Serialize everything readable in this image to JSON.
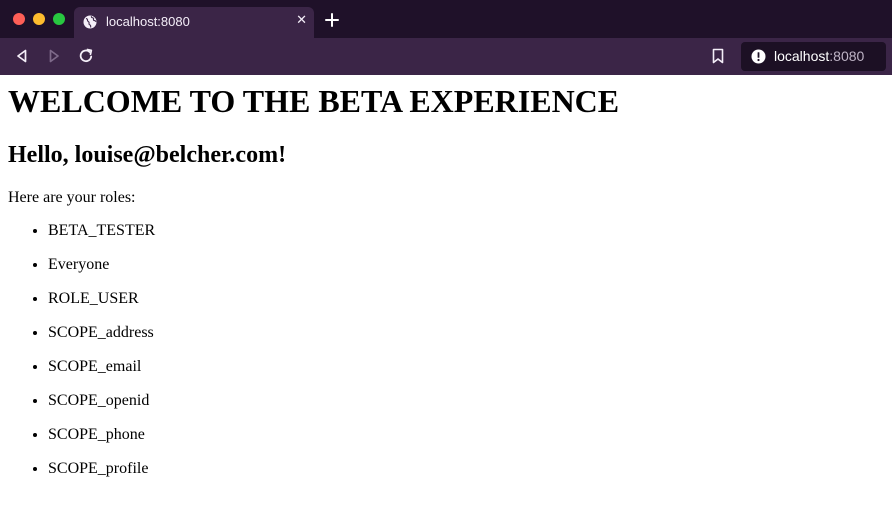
{
  "browser": {
    "tab": {
      "title": "localhost:8080",
      "close_glyph": "✕",
      "icon": "globe-icon"
    },
    "new_tab_icon": "plus-icon",
    "nav": {
      "back_icon": "back-icon",
      "forward_icon": "forward-icon",
      "reload_icon": "reload-icon"
    },
    "bookmark_icon": "bookmark-icon",
    "address": {
      "host": "localhost",
      "port": ":8080",
      "info_icon": "info-icon"
    },
    "colors": {
      "tabbar": "#1f1129",
      "toolbar": "#3b2547",
      "urlbar": "#1c1024"
    }
  },
  "page": {
    "heading": "WELCOME TO THE BETA EXPERIENCE",
    "greeting": "Hello, louise@belcher.com!",
    "roles_intro": "Here are your roles:",
    "roles": [
      "BETA_TESTER",
      "Everyone",
      "ROLE_USER",
      "SCOPE_address",
      "SCOPE_email",
      "SCOPE_openid",
      "SCOPE_phone",
      "SCOPE_profile"
    ]
  }
}
